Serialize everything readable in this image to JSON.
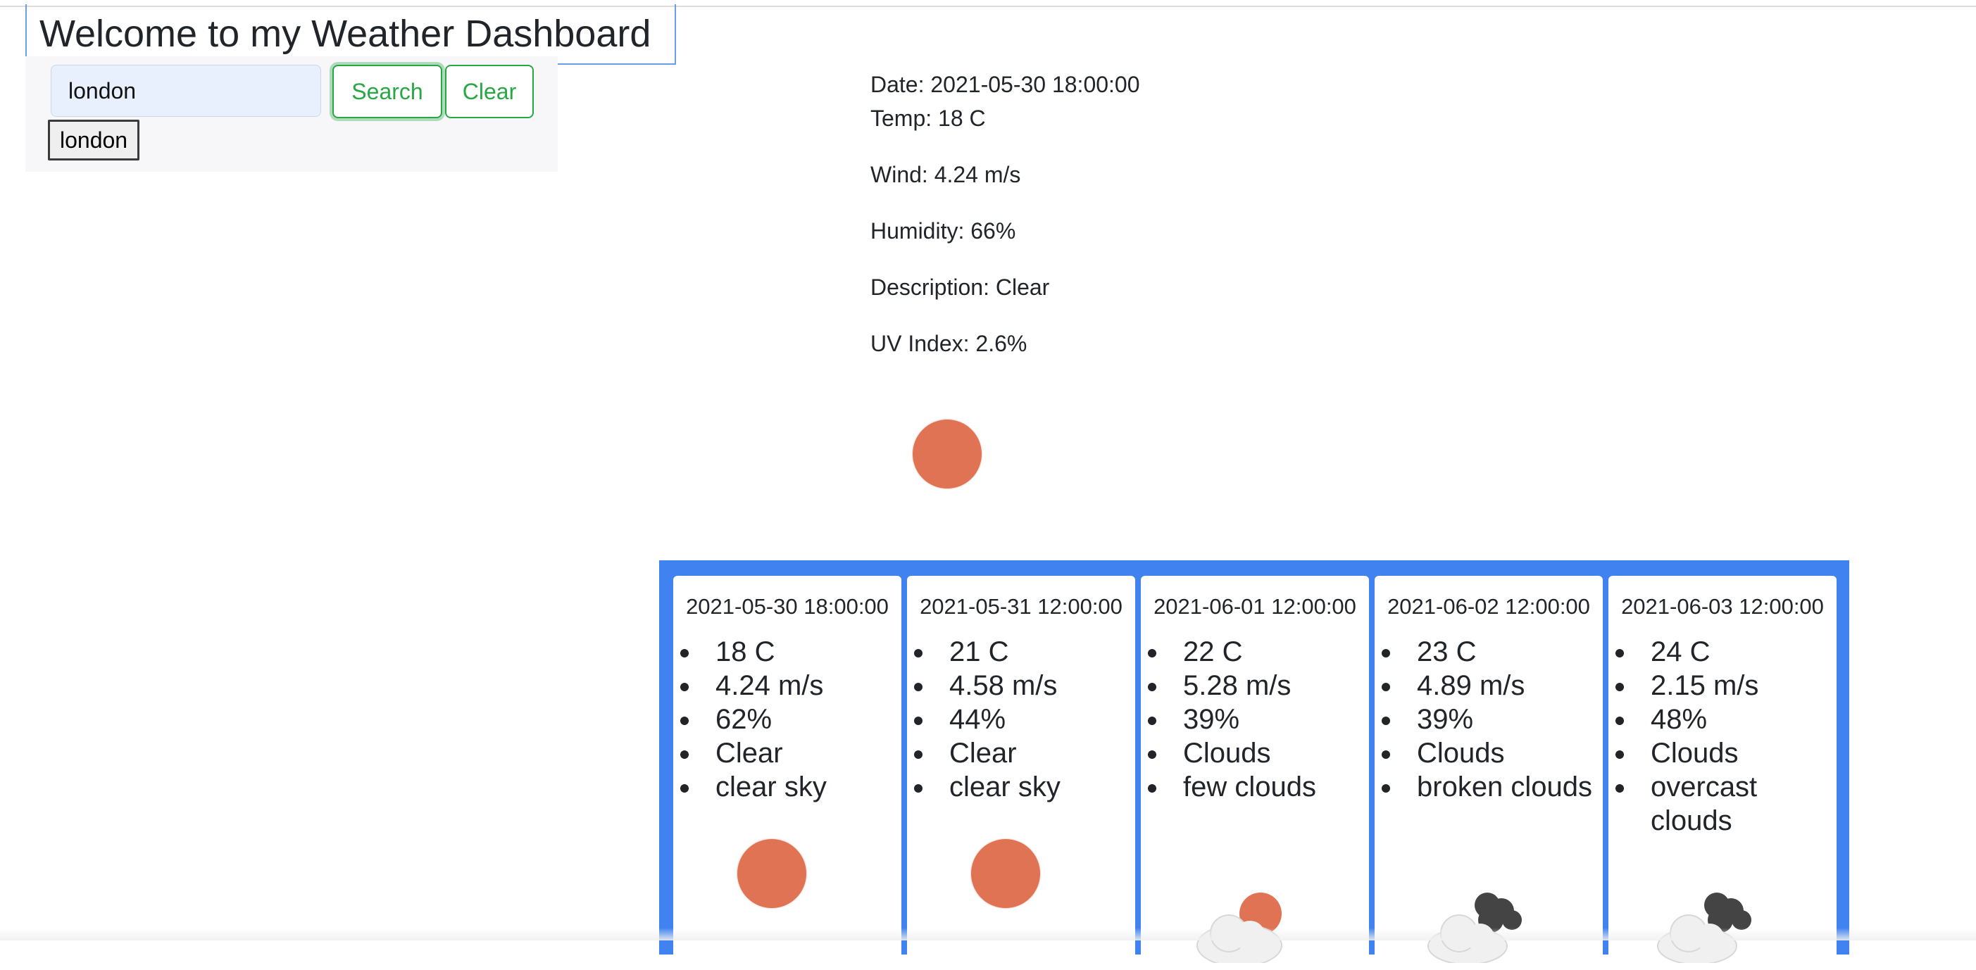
{
  "header": {
    "title": "Welcome to my Weather Dashboard"
  },
  "search": {
    "value": "london",
    "search_label": "Search",
    "clear_label": "Clear",
    "history": [
      "london"
    ]
  },
  "current": {
    "date": "Date: 2021-05-30 18:00:00",
    "temp": "Temp: 18 C",
    "wind": "Wind: 4.24 m/s",
    "humidity": "Humidity: 66%",
    "description": "Description: Clear",
    "uv": "UV Index: 2.6%",
    "icon": "sun-icon"
  },
  "forecast": [
    {
      "date": "2021-05-30 18:00:00",
      "temp": "18 C",
      "wind": "4.24 m/s",
      "humidity": "62%",
      "main": "Clear",
      "desc": "clear sky",
      "icon": "sun-icon"
    },
    {
      "date": "2021-05-31 12:00:00",
      "temp": "21 C",
      "wind": "4.58 m/s",
      "humidity": "44%",
      "main": "Clear",
      "desc": "clear sky",
      "icon": "sun-icon"
    },
    {
      "date": "2021-06-01 12:00:00",
      "temp": "22 C",
      "wind": "5.28 m/s",
      "humidity": "39%",
      "main": "Clouds",
      "desc": "few clouds",
      "icon": "few-clouds-icon"
    },
    {
      "date": "2021-06-02 12:00:00",
      "temp": "23 C",
      "wind": "4.89 m/s",
      "humidity": "39%",
      "main": "Clouds",
      "desc": "broken clouds",
      "icon": "broken-clouds-icon"
    },
    {
      "date": "2021-06-03 12:00:00",
      "temp": "24 C",
      "wind": "2.15 m/s",
      "humidity": "48%",
      "main": "Clouds",
      "desc": "overcast clouds",
      "icon": "overcast-clouds-icon"
    }
  ],
  "colors": {
    "accent_green": "#28a745",
    "forecast_bg": "#3f82f0",
    "sun": "#df7354"
  }
}
